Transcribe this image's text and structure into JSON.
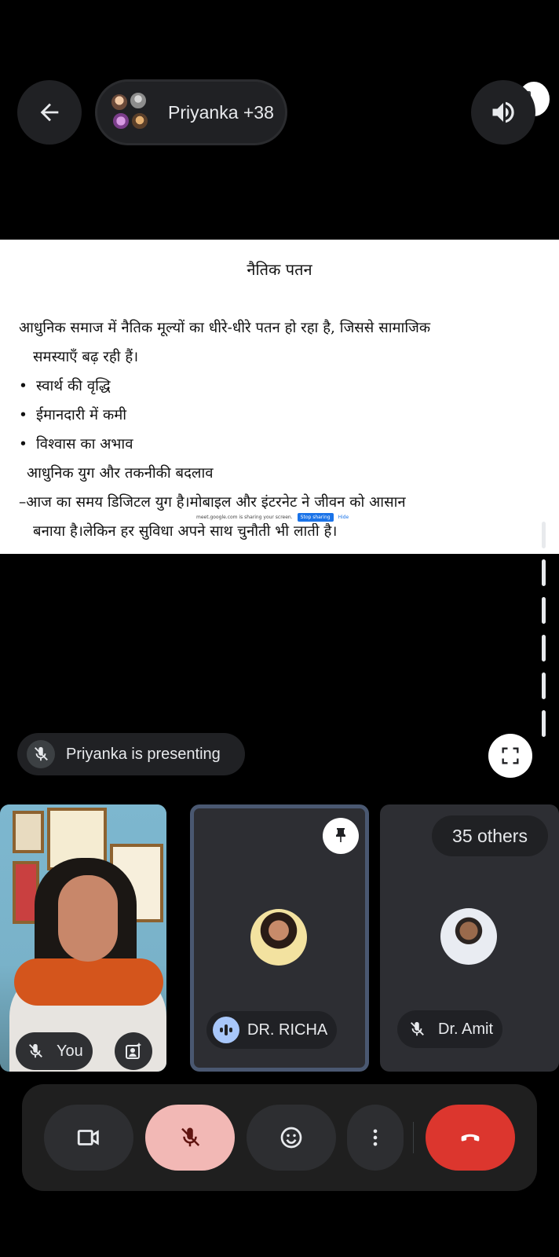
{
  "header": {
    "back_label": "Back",
    "participants_label": "Priyanka +38"
  },
  "presentation": {
    "title": "नैतिक पतन",
    "paragraph1_line1": "आधुनिक समाज में नैतिक मूल्यों का धीरे-धीरे पतन हो रहा है, जिससे सामाजिक",
    "paragraph1_line2": "समस्याएँ बढ़ रही हैं।",
    "bullets": [
      "स्वार्थ की वृद्धि",
      "ईमानदारी में कमी",
      "विश्वास का अभाव"
    ],
    "subheading": "आधुनिक युग और तकनीकी बदलाव",
    "paragraph2_line1": "–आज का समय डिजिटल युग है।मोबाइल और इंटरनेट ने जीवन को आसान",
    "paragraph2_line2": "बनाया है।लेकिन हर सुविधा अपने साथ चुनौती भी लाती है।",
    "share_banner": {
      "text": "meet.google.com is sharing your screen.",
      "stop_label": "Stop sharing",
      "hide_label": "Hide"
    }
  },
  "presenting_label": "Priyanka is presenting",
  "tiles": {
    "you_label": "You",
    "richa_label": "DR. RICHA",
    "others_label": "35 others",
    "amit_label": "Dr. Amit"
  },
  "colors": {
    "background": "#000000",
    "surface": "#202124",
    "mic_off_bg": "#f2b8b5",
    "leave_bg": "#dc362e",
    "active_speaker_border": "#4a5871"
  },
  "icons": {
    "back": "arrow-left-icon",
    "speaker": "volume-icon",
    "mic_off": "mic-off-icon",
    "fullscreen": "fullscreen-icon",
    "pin": "pin-icon",
    "effects": "effects-icon",
    "camera": "camera-icon",
    "reactions": "emoji-icon",
    "more": "more-vert-icon",
    "leave": "call-end-icon"
  }
}
